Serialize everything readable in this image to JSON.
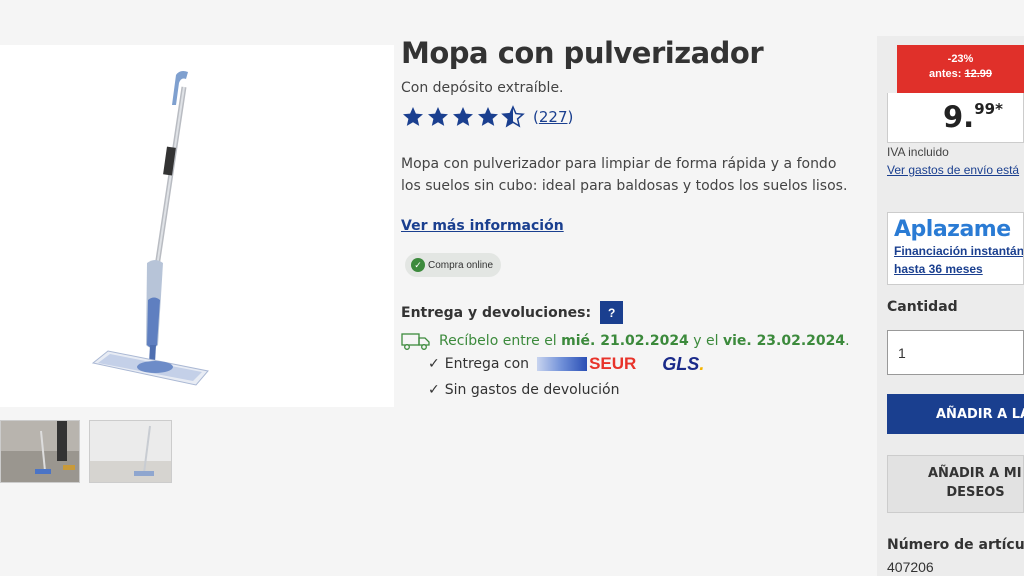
{
  "product": {
    "title": "Mopa con pulverizador",
    "subtitle": "Con depósito extraíble.",
    "rating": 4.5,
    "review_count": "227",
    "description": "Mopa con pulverizador para limpiar de forma rápida y a fondo los suelos sin cubo: ideal para baldosas y todos los suelos lisos.",
    "more_info_link": "Ver más información",
    "online_badge": "Compra online"
  },
  "delivery": {
    "heading": "Entrega y devoluciones:",
    "help_label": "?",
    "receive_prefix": "Recíbelo entre el",
    "date_from": "mié. 21.02.2024",
    "connector": "y el",
    "date_to": "vie. 23.02.2024",
    "period": ".",
    "carrier_label": "Entrega con",
    "carrier_1": "SEUR",
    "carrier_2": "GLS",
    "carrier_2_dot": ".",
    "returns": "Sin gastos de devolución",
    "tick": "✓"
  },
  "purchase": {
    "discount": "-23%",
    "before_label": "antes:",
    "old_price": "12.99",
    "price_int": "9.",
    "price_dec": "99*",
    "vat": "IVA incluido",
    "shipping_link": "Ver gastos de envío está",
    "aplazame_logo": "Aplazame",
    "aplazame_line1": "Financiación instantán",
    "aplazame_line2": "hasta 36 meses",
    "quantity_label": "Cantidad",
    "quantity_value": "1",
    "add_to_cart": "AÑADIR A LA C",
    "wishlist_line1": "AÑADIR A MI LI",
    "wishlist_line2": "DESEOS",
    "article_label": "Número de artículo:",
    "article_number": "407206"
  },
  "colors": {
    "brand_blue": "#1a3f8f",
    "discount_red": "#e0302a",
    "delivery_green": "#3c8a3c"
  },
  "icons": [
    "star-icon",
    "star-half-icon",
    "check-circle-icon",
    "truck-icon",
    "help-icon"
  ]
}
